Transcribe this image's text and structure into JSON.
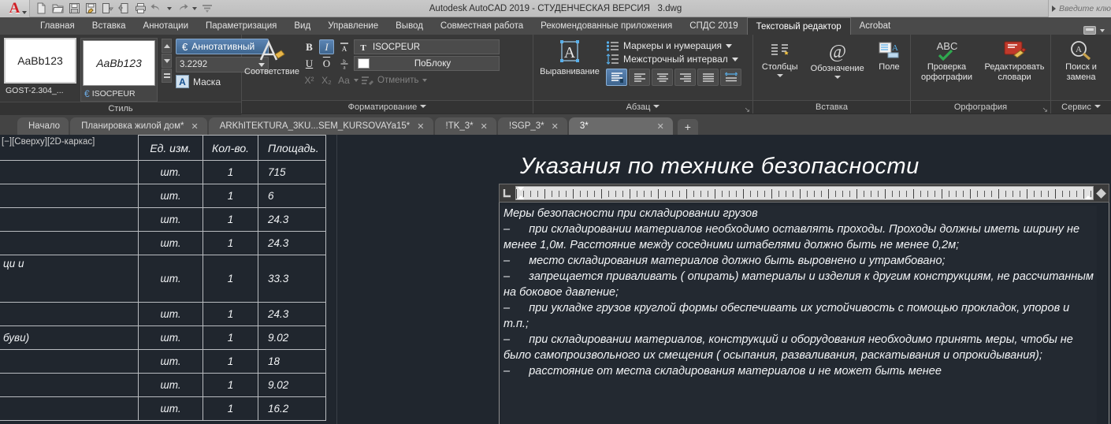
{
  "titlebar": {
    "app_letter": "A",
    "title": "Autodesk AutoCAD 2019 - СТУДЕНЧЕСКАЯ ВЕРСИЯ   3.dwg",
    "search_placeholder": "Введите клю",
    "quick_access": [
      {
        "name": "new-icon",
        "label": "Создать"
      },
      {
        "name": "open-icon",
        "label": "Открыть"
      },
      {
        "name": "save-icon",
        "label": "Сохранить"
      },
      {
        "name": "save-as-icon",
        "label": "Сохранить как"
      },
      {
        "name": "plot-preview-icon",
        "label": "Предварительный просмотр"
      },
      {
        "name": "export-icon",
        "label": "Экспорт"
      },
      {
        "name": "print-icon",
        "label": "Печать"
      },
      {
        "name": "undo-icon",
        "label": "Отменить"
      },
      {
        "name": "redo-icon",
        "label": "Повторить"
      },
      {
        "name": "customize-qat-icon",
        "label": "Настройка"
      }
    ]
  },
  "ribbon_tabs": {
    "items": [
      {
        "label": "Главная",
        "active": false
      },
      {
        "label": "Вставка",
        "active": false
      },
      {
        "label": "Аннотации",
        "active": false
      },
      {
        "label": "Параметризация",
        "active": false
      },
      {
        "label": "Вид",
        "active": false
      },
      {
        "label": "Управление",
        "active": false
      },
      {
        "label": "Вывод",
        "active": false
      },
      {
        "label": "Совместная работа",
        "active": false
      },
      {
        "label": "Рекомендованные приложения",
        "active": false
      },
      {
        "label": "СПДС 2019",
        "active": false
      },
      {
        "label": "Текстовый редактор",
        "active": true
      },
      {
        "label": "Acrobat",
        "active": false
      }
    ]
  },
  "ribbon": {
    "style_panel": {
      "title": "Стиль",
      "sample_text_1": "AaBb123",
      "style_name_1": "GOST-2.304_...",
      "sample_text_2": "AaBb123",
      "style_name_2": "ISOCPEUR",
      "annotative_label": "Аннотативный",
      "height_value": "3.2292",
      "mask_label": "Маска",
      "mask_icon_letter": "A"
    },
    "format_panel": {
      "title": "Форматирование",
      "match_label": "Соответствие",
      "bold": "B",
      "italic": "I",
      "overline_top": "A",
      "underline": "U",
      "overline": "O",
      "stack": "b/a",
      "superscript": "X²",
      "subscript": "X₂",
      "case_label": "Aa",
      "clear_label": "Отменить",
      "font_value": "ISOCPEUR",
      "color_value": "ПоБлоку"
    },
    "paragraph_panel": {
      "title": "Абзац",
      "justify_label": "Выравнивание",
      "bullets_label": "Маркеры и нумерация",
      "linespacing_label": "Межстрочный интервал",
      "align_buttons": [
        {
          "name": "align-paragraph-icon",
          "active": true
        },
        {
          "name": "align-left-icon",
          "active": false
        },
        {
          "name": "align-center-icon",
          "active": false
        },
        {
          "name": "align-right-icon",
          "active": false
        },
        {
          "name": "align-justify-icon",
          "active": false
        },
        {
          "name": "align-distribute-icon",
          "active": false
        }
      ]
    },
    "insert_panel": {
      "title": "Вставка",
      "items": [
        {
          "label": "Столбцы",
          "icon": "columns-icon",
          "dropdown": true
        },
        {
          "label": "Обозначение",
          "icon": "symbol-at-icon",
          "dropdown": true
        },
        {
          "label": "Поле",
          "icon": "field-icon",
          "dropdown": false
        }
      ]
    },
    "spelling_panel": {
      "title": "Орфография",
      "items": [
        {
          "label": "Проверка\nорфографии",
          "icon": "spellcheck-abc-icon"
        },
        {
          "label": "Редактировать\nсловари",
          "icon": "edit-dictionaries-icon"
        }
      ]
    },
    "tools_panel": {
      "title": "Сервис",
      "items": [
        {
          "label": "Поиск и\nзамена",
          "icon": "find-replace-icon"
        }
      ]
    }
  },
  "file_tabs": {
    "items": [
      {
        "label": "Начало",
        "closable": false,
        "active": false
      },
      {
        "label": "Планировка жилой дом*",
        "closable": true,
        "active": false
      },
      {
        "label": "ARKhITEKTURA_3KU...SEM_KURSOVAYa15*",
        "closable": true,
        "active": false
      },
      {
        "label": "!TK_3*",
        "closable": true,
        "active": false
      },
      {
        "label": "!SGP_3*",
        "closable": true,
        "active": false
      },
      {
        "label": "3*",
        "closable": true,
        "active": true
      }
    ],
    "add_label": "+"
  },
  "canvas": {
    "viewport_label": "[−][Сверху][2D-каркас]",
    "table": {
      "headers": [
        "",
        "Ед. изм.",
        "Кол-во.",
        "Площадь."
      ],
      "rows": [
        {
          "desc": "",
          "unit": "шт.",
          "qty": "1",
          "area": "715"
        },
        {
          "desc": "",
          "unit": "шт.",
          "qty": "1",
          "area": "6"
        },
        {
          "desc": "",
          "unit": "шт.",
          "qty": "1",
          "area": "24.3"
        },
        {
          "desc": "",
          "unit": "шт.",
          "qty": "1",
          "area": "24.3"
        },
        {
          "desc": "ци и",
          "unit": "шт.",
          "qty": "1",
          "area": "33.3"
        },
        {
          "desc": "",
          "unit": "шт.",
          "qty": "1",
          "area": "24.3"
        },
        {
          "desc": "буви)",
          "unit": "шт.",
          "qty": "1",
          "area": "9.02"
        },
        {
          "desc": "",
          "unit": "шт.",
          "qty": "1",
          "area": "18"
        },
        {
          "desc": "",
          "unit": "шт.",
          "qty": "1",
          "area": "9.02"
        },
        {
          "desc": "",
          "unit": "шт.",
          "qty": "1",
          "area": "16.2"
        }
      ]
    },
    "mtext": {
      "heading": "Указания по технике безопасности",
      "body": "Меры безопасности при складировании грузов\n–      при складировании материалов необходимо оставлять проходы. Проходы должны иметь ширину не менее 1,0м. Расстояние между соседними штабелями должно быть не менее 0,2м;\n–      место складирования материалов должно быть выровнено и утрамбовано;\n–      запрещается приваливать ( опирать) материалы и изделия к другим конструкциям, не рассчитанным на боковое давление;\n–      при укладке грузов круглой формы обеспечивать их устойчивость с помощью прокладок, упоров и т.п.;\n–      при складировании материалов, конструкций и оборудования необходимо принять меры, чтобы не было самопроизвольного их смещения ( осыпания, разваливания, раскатывания и опрокидывания);\n–      расстояние от места складирования материалов и не может быть менее"
    }
  },
  "colors": {
    "accent_blue": "#4f7cab",
    "canvas_bg": "#20262e",
    "ribbon_bg": "#383838",
    "titlebar_bg": "#c9c9c9",
    "logo_red": "#cf2026"
  }
}
